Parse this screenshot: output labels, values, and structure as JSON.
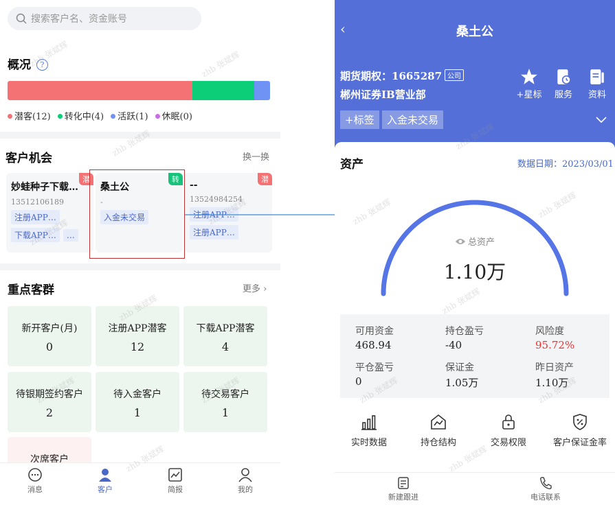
{
  "left": {
    "search": {
      "placeholder": "搜索客户名、资金账号"
    },
    "overview": {
      "title": "概况",
      "help_label": "?",
      "bar": [
        {
          "key": "qianke",
          "fraction": 0.705,
          "color": "#f47274"
        },
        {
          "key": "zhuanhua",
          "fraction": 0.235,
          "color": "#0ccd78"
        },
        {
          "key": "huoyue",
          "fraction": 0.06,
          "color": "#6f93f4"
        }
      ],
      "legend": [
        {
          "label": "潜客(12)",
          "color": "#f47274"
        },
        {
          "label": "转化中(4)",
          "color": "#0ccd78"
        },
        {
          "label": "活跃(1)",
          "color": "#6f93f4"
        },
        {
          "label": "休眠(0)",
          "color": "#c86ee0"
        }
      ]
    },
    "opportunities": {
      "title": "客户机会",
      "refresh_label": "换一换",
      "cards": [
        {
          "name": "妙蛙种子下载…",
          "sub": "13512106189",
          "badge": "潜",
          "badge_color": "#f47274",
          "tags": [
            "注册APP…",
            "下载APP…",
            "…"
          ]
        },
        {
          "name": "桑土公",
          "sub": "-",
          "badge": "转",
          "badge_color": "#19c27a",
          "tags": [
            "入金未交易"
          ]
        },
        {
          "name": "--",
          "sub": "13524984254",
          "badge": "潜",
          "badge_color": "#f47274",
          "tags": [
            "注册APP…",
            "注册APP…"
          ]
        }
      ]
    },
    "groups": {
      "title": "重点客群",
      "more_label": "更多",
      "items": [
        {
          "label": "新开客户(月)",
          "value": "0"
        },
        {
          "label": "注册APP潜客",
          "value": "12"
        },
        {
          "label": "下载APP潜客",
          "value": "4"
        },
        {
          "label": "待银期签约客户",
          "value": "2"
        },
        {
          "label": "待入金客户",
          "value": "1"
        },
        {
          "label": "待交易客户",
          "value": "1"
        },
        {
          "label": "次席客户",
          "value": ""
        }
      ]
    },
    "tabbar": [
      {
        "label": "消息",
        "icon": "message-icon"
      },
      {
        "label": "客户",
        "icon": "customer-icon"
      },
      {
        "label": "简报",
        "icon": "report-icon"
      },
      {
        "label": "我的",
        "icon": "profile-icon"
      }
    ]
  },
  "right": {
    "title": "桑土公",
    "account_label": "期货期权：1665287",
    "account_type": "公司",
    "branch": "郴州证券IB营业部",
    "actions": [
      {
        "label": "+星标",
        "icon": "star-icon"
      },
      {
        "label": "服务",
        "icon": "service-icon"
      },
      {
        "label": "资料",
        "icon": "document-icon"
      }
    ],
    "chips": [
      "+标签",
      "入金未交易"
    ],
    "assets": {
      "title": "资产",
      "date_label": "数据日期：2023/03/01",
      "gauge_title": "总资产",
      "gauge_value": "1.10万"
    },
    "stats": [
      {
        "label": "可用资金",
        "value": "468.94",
        "color": "#222"
      },
      {
        "label": "持仓盈亏",
        "value": "-40",
        "color": "#222"
      },
      {
        "label": "风险度",
        "value": "95.72%",
        "color": "#e33"
      },
      {
        "label": "平仓盈亏",
        "value": "0",
        "color": "#222"
      },
      {
        "label": "保证金",
        "value": "1.05万",
        "color": "#222"
      },
      {
        "label": "昨日资产",
        "value": "1.10万",
        "color": "#222"
      }
    ],
    "tools": [
      {
        "label": "实时数据",
        "icon": "bar-chart-icon"
      },
      {
        "label": "持仓结构",
        "icon": "position-icon"
      },
      {
        "label": "交易权限",
        "icon": "lock-icon"
      },
      {
        "label": "客户保证金率",
        "icon": "shield-percent-icon"
      }
    ],
    "bottom": [
      {
        "label": "新建跟进",
        "icon": "follow-up-icon"
      },
      {
        "label": "电话联系",
        "icon": "phone-icon"
      }
    ]
  },
  "watermark": "zhb 张斌辉",
  "colors": {
    "primary": "#5470d8",
    "accent_blue": "#4a68c8",
    "red": "#e33"
  }
}
